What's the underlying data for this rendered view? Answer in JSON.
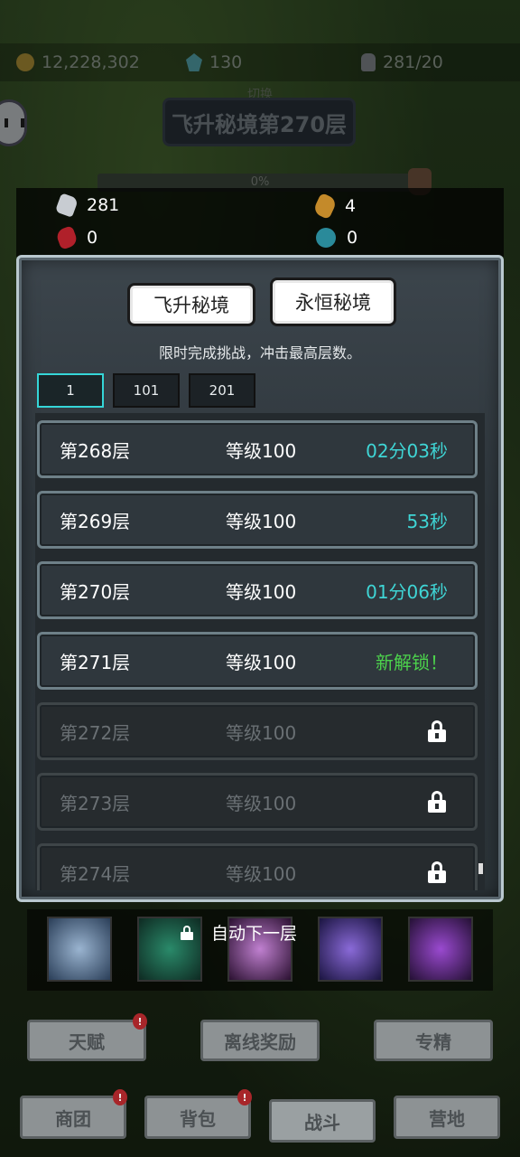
{
  "hud": {
    "gold": "12,228,302",
    "gems": "130",
    "stamina": "281/20"
  },
  "stage": {
    "small_label": "切换",
    "title": "飞升秘境第270层",
    "progress_text": "0%"
  },
  "resources": [
    {
      "icon": "ore-icon",
      "value": "281"
    },
    {
      "icon": "gold-ore-icon",
      "value": "4"
    },
    {
      "icon": "red-crystal-icon",
      "value": "0"
    },
    {
      "icon": "teal-token-icon",
      "value": "0"
    }
  ],
  "dialog": {
    "tabs": [
      {
        "label": "飞升秘境"
      },
      {
        "label": "永恒秘境"
      }
    ],
    "subtitle": "限时完成挑战，冲击最高层数。",
    "pages": [
      "1",
      "101",
      "201"
    ],
    "active_page": "1",
    "floors": [
      {
        "floor": "第268层",
        "level": "等级100",
        "status": "02分03秒",
        "state": "cleared"
      },
      {
        "floor": "第269层",
        "level": "等级100",
        "status": "53秒",
        "state": "cleared"
      },
      {
        "floor": "第270层",
        "level": "等级100",
        "status": "01分06秒",
        "state": "cleared"
      },
      {
        "floor": "第271层",
        "level": "等级100",
        "status": "新解锁！",
        "state": "unlocked"
      },
      {
        "floor": "第272层",
        "level": "等级100",
        "status": "",
        "state": "locked"
      },
      {
        "floor": "第273层",
        "level": "等级100",
        "status": "",
        "state": "locked"
      },
      {
        "floor": "第274层",
        "level": "等级100",
        "status": "",
        "state": "locked"
      }
    ]
  },
  "auto_next": "自动下一层",
  "bottom": {
    "row1": [
      "天赋",
      "离线奖励",
      "专精"
    ],
    "row2": [
      "商团",
      "背包",
      "战斗",
      "营地"
    ],
    "badge": "!"
  },
  "colors": {
    "time_cyan": "#3fd5d5",
    "unlock_green": "#4cd24c",
    "active_page_border": "#35d6d8"
  }
}
